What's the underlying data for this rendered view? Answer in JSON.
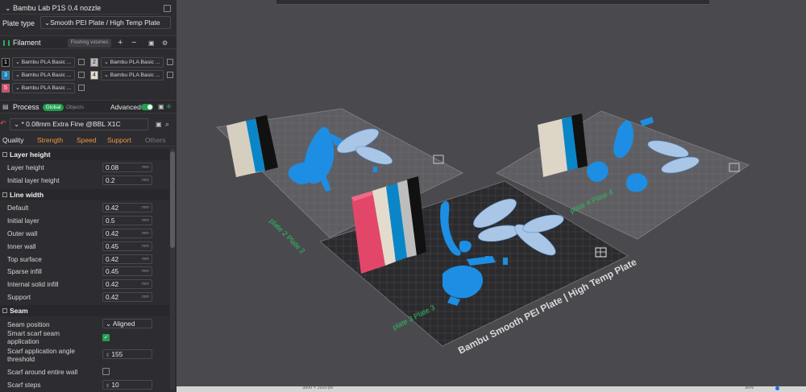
{
  "printer": {
    "name": "Bambu Lab P1S 0.4 nozzle"
  },
  "plate": {
    "label": "Plate type",
    "value": "Smooth PEI Plate / High Temp Plate"
  },
  "filament": {
    "title": "Filament",
    "flush_label": "Flushing volumes",
    "items": [
      {
        "index": "1",
        "color": "#111111",
        "name": "Bambu PLA Basic ..."
      },
      {
        "index": "2",
        "color": "#bdbdbd",
        "name": "Bambu PLA Basic ..."
      },
      {
        "index": "3",
        "color": "#0a86c8",
        "name": "Bambu PLA Basic ..."
      },
      {
        "index": "4",
        "color": "#e3dccd",
        "name": "Bambu PLA Basic ..."
      },
      {
        "index": "5",
        "color": "#e2476a",
        "name": "Bambu PLA Basic ..."
      }
    ]
  },
  "process": {
    "title": "Process",
    "global_label": "Global",
    "objects_label": "Objects",
    "advanced_label": "Advanced",
    "preset": "* 0.08mm Extra Fine @BBL X1C",
    "tabs": [
      "Quality",
      "Strength",
      "Speed",
      "Support",
      "Others"
    ]
  },
  "params": {
    "layer_height": {
      "title": "Layer height",
      "rows": [
        {
          "label": "Layer height",
          "value": "0.08",
          "unit": "mm"
        },
        {
          "label": "Initial layer height",
          "value": "0.2",
          "unit": "mm"
        }
      ]
    },
    "line_width": {
      "title": "Line width",
      "rows": [
        {
          "label": "Default",
          "value": "0.42",
          "unit": "mm"
        },
        {
          "label": "Initial layer",
          "value": "0.5",
          "unit": "mm"
        },
        {
          "label": "Outer wall",
          "value": "0.42",
          "unit": "mm"
        },
        {
          "label": "Inner wall",
          "value": "0.45",
          "unit": "mm"
        },
        {
          "label": "Top surface",
          "value": "0.42",
          "unit": "mm"
        },
        {
          "label": "Sparse infill",
          "value": "0.45",
          "unit": "mm"
        },
        {
          "label": "Internal solid infill",
          "value": "0.42",
          "unit": "mm"
        },
        {
          "label": "Support",
          "value": "0.42",
          "unit": "mm"
        }
      ]
    },
    "seam": {
      "title": "Seam",
      "position_label": "Seam position",
      "position_value": "Aligned",
      "smart_scarf_label": "Smart scarf seam application",
      "smart_scarf_checked": true,
      "scarf_angle_label": "Scarf application angle threshold",
      "scarf_angle_value": "155",
      "scarf_entire_label": "Scarf around entire wall",
      "scarf_entire_checked": false,
      "scarf_steps_label": "Scarf steps",
      "scarf_steps_value": "10"
    }
  },
  "viewport": {
    "plate_text": "Bambu Smooth PEI Plate | High Temp Plate",
    "plate3_label": "plate 3 Plate 3",
    "plate2_label": "plate 2 Plate 2",
    "plate4_label": "plate 4 Plate 4",
    "status_left": "3000 × 1920 px",
    "status_right": "30%"
  }
}
